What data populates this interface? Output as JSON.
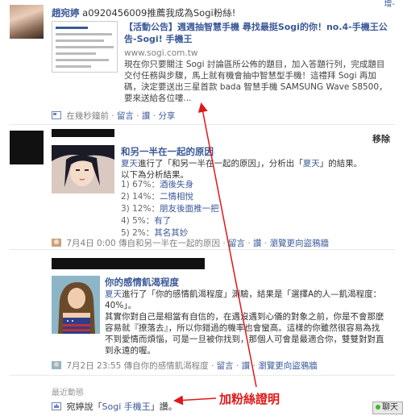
{
  "top_fragment": "增-",
  "story1": {
    "actor": "趙宛婷",
    "action": "a0920456009推薦我成為Sogi粉絲!",
    "share_title": "【活動公告】週週抽智慧手機 尋找最挺Sogi的你！no.4-手機王公告-Sogi! 手機王",
    "share_url": "www.sogi.com.tw",
    "share_desc": "現在你只要關注 Sogi 討論區所公佈的題目，加入答題行列，完成題目交付任務與步驟，馬上就有機會抽中智慧型手機！這禮拜 Sogi 再加碼，決定要送出三星首款 bada 智慧手機 SAMSUNG Wave S8500，要來送給各位嘍...",
    "footer": {
      "time": "在幾秒鐘前",
      "comment": "留言",
      "like": "讚",
      "share": "分享"
    }
  },
  "story2": {
    "actor_visible": "夏天進行了",
    "remove": "移除",
    "app_title": "和另一半在一起的原因",
    "desc_user": "夏天",
    "desc_mid": "進行了「和另一半在一起的原因」，分析出「",
    "desc_user2": "夏天",
    "desc_end": "」的結果。",
    "desc2": "以下為分析結果。",
    "options": [
      {
        "pct": "1) 67%：",
        "label": "酒後失身"
      },
      {
        "pct": "2) 14%：",
        "label": "二情相悅"
      },
      {
        "pct": "3) 12%：",
        "label": "朋友後面推一把"
      },
      {
        "pct": "4) 5%：",
        "label": "有了"
      },
      {
        "pct": "5) 2%：",
        "label": "其名其妙"
      }
    ],
    "footer": {
      "time": "7月4日 0:00 傳自和另一半在一起的原因",
      "comment": "留言",
      "like": "讚",
      "extra": "瀏覽更向盜鴉牆"
    }
  },
  "story3": {
    "app_title": "你的感情飢渴程度",
    "desc_user": "夏天",
    "desc_mid": "進行了「你的感情飢渴程度」測驗，結果是「選擇A的人—飢渴程度：40%」。",
    "desc2": "其實你對自己是相當有自信的，在遇沒遇到心儀的對象之前，你是不會那麼容易就『撩落去』，所以你錯過的機率也會蠻高。這樣的你雖然很容易為找不到愛情而煩惱，可是一旦被你找到，那個人可會是最適合你，雙雙對對直到永遠的喔。",
    "footer": {
      "time": "7月2日 23:55 傳自你的感情飢渴程度",
      "comment": "留言",
      "like": "讚",
      "extra": "瀏覽更向盜鴉牆"
    }
  },
  "recent": {
    "label": "最近動態",
    "text_prefix": "宛婷說「",
    "page": "Sogi 手機王",
    "text_suffix": "」讚。"
  },
  "annotation": "加粉絲證明",
  "chat": "聊天",
  "colors": {
    "link": "#3b5998",
    "annotation": "#e01818"
  }
}
